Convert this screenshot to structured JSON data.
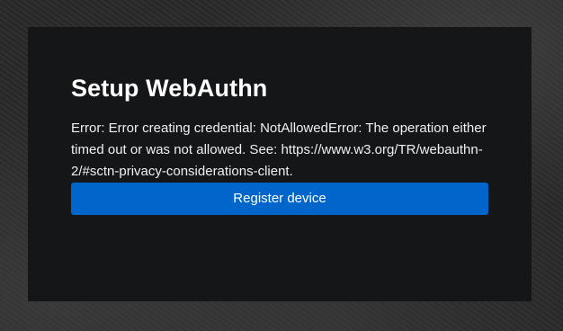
{
  "dialog": {
    "title": "Setup WebAuthn",
    "error_message": "Error: Error creating credential: NotAllowedError: The operation either timed out or was not allowed. See: https://www.w3.org/TR/webauthn-2/#sctn-privacy-considerations-client.",
    "register_button_label": "Register device"
  },
  "colors": {
    "card_background": "#151618",
    "button_primary": "#0066cc",
    "text": "#ffffff"
  }
}
